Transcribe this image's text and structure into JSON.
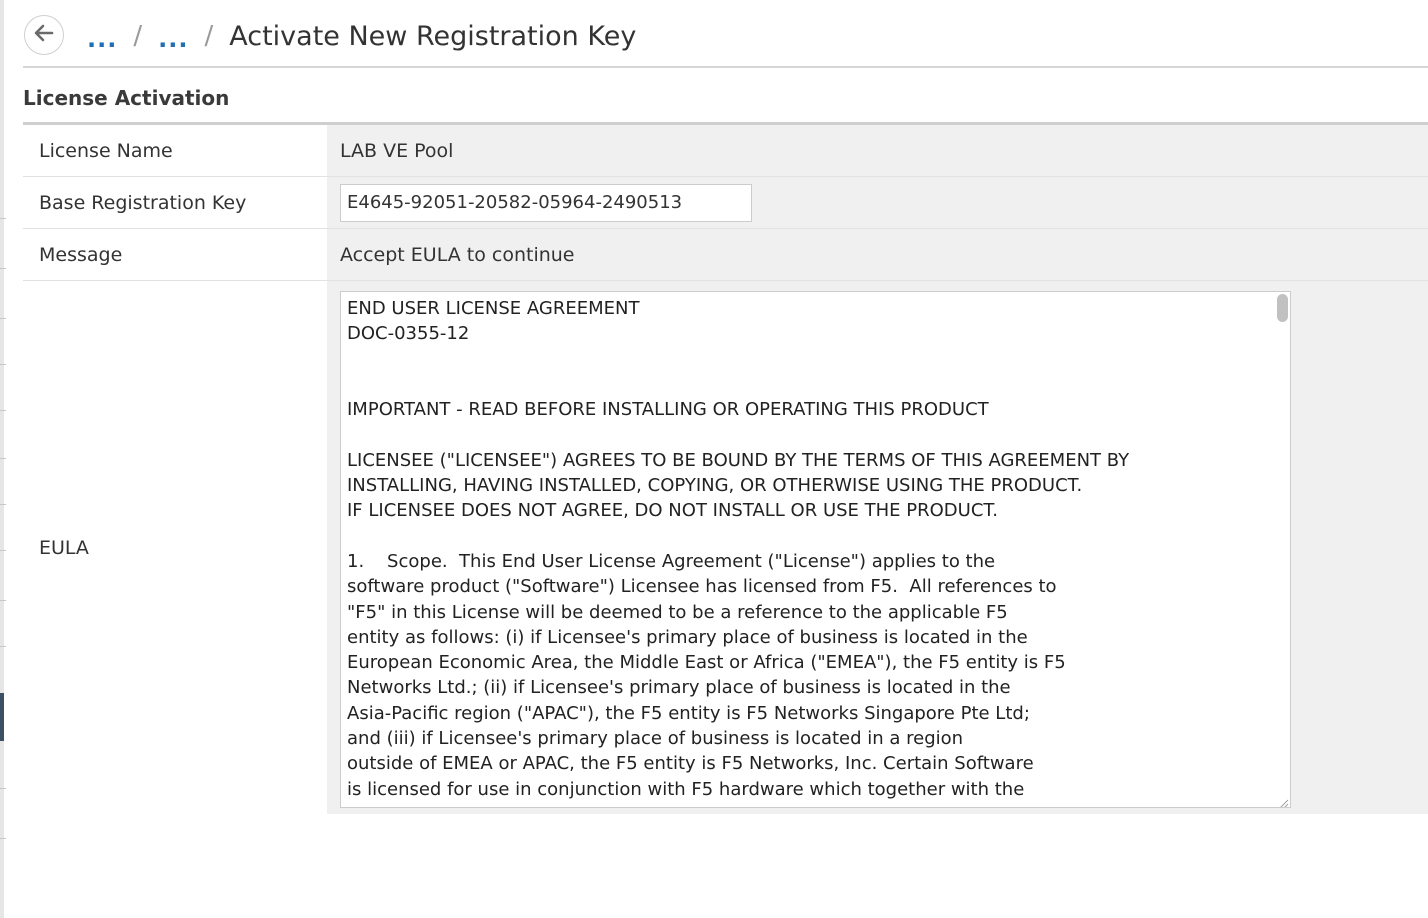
{
  "header": {
    "back_icon": "arrow-left-icon",
    "breadcrumb": {
      "crumb1": "...",
      "crumb2": "...",
      "separator": "/",
      "current": "Activate New Registration Key"
    }
  },
  "section": {
    "title": "License Activation"
  },
  "form": {
    "license_name_label": "License Name",
    "license_name_value": "LAB VE Pool",
    "base_key_label": "Base Registration Key",
    "base_key_value": "E4645-92051-20582-05964-2490513",
    "message_label": "Message",
    "message_value": "Accept EULA to continue",
    "eula_label": "EULA",
    "eula_text": "END USER LICENSE AGREEMENT\nDOC-0355-12\n\n\nIMPORTANT - READ BEFORE INSTALLING OR OPERATING THIS PRODUCT\n\nLICENSEE (\"LICENSEE\") AGREES TO BE BOUND BY THE TERMS OF THIS AGREEMENT BY\nINSTALLING, HAVING INSTALLED, COPYING, OR OTHERWISE USING THE PRODUCT.\nIF LICENSEE DOES NOT AGREE, DO NOT INSTALL OR USE THE PRODUCT.\n\n1.    Scope.  This End User License Agreement (\"License\") applies to the\nsoftware product (\"Software\") Licensee has licensed from F5.  All references to\n\"F5\" in this License will be deemed to be a reference to the applicable F5\nentity as follows: (i) if Licensee's primary place of business is located in the\nEuropean Economic Area, the Middle East or Africa (\"EMEA\"), the F5 entity is F5\nNetworks Ltd.; (ii) if Licensee's primary place of business is located in the\nAsia-Pacific region (\"APAC\"), the F5 entity is F5 Networks Singapore Pte Ltd;\nand (iii) if Licensee's primary place of business is located in a region\noutside of EMEA or APAC, the F5 entity is F5 Networks, Inc. Certain Software\nis licensed for use in conjunction with F5 hardware which together with the"
  },
  "colors": {
    "link": "#1f6fb5",
    "label_bg": "#ffffff",
    "value_bg": "#f0f0f0",
    "divider": "#cfcfcf"
  }
}
